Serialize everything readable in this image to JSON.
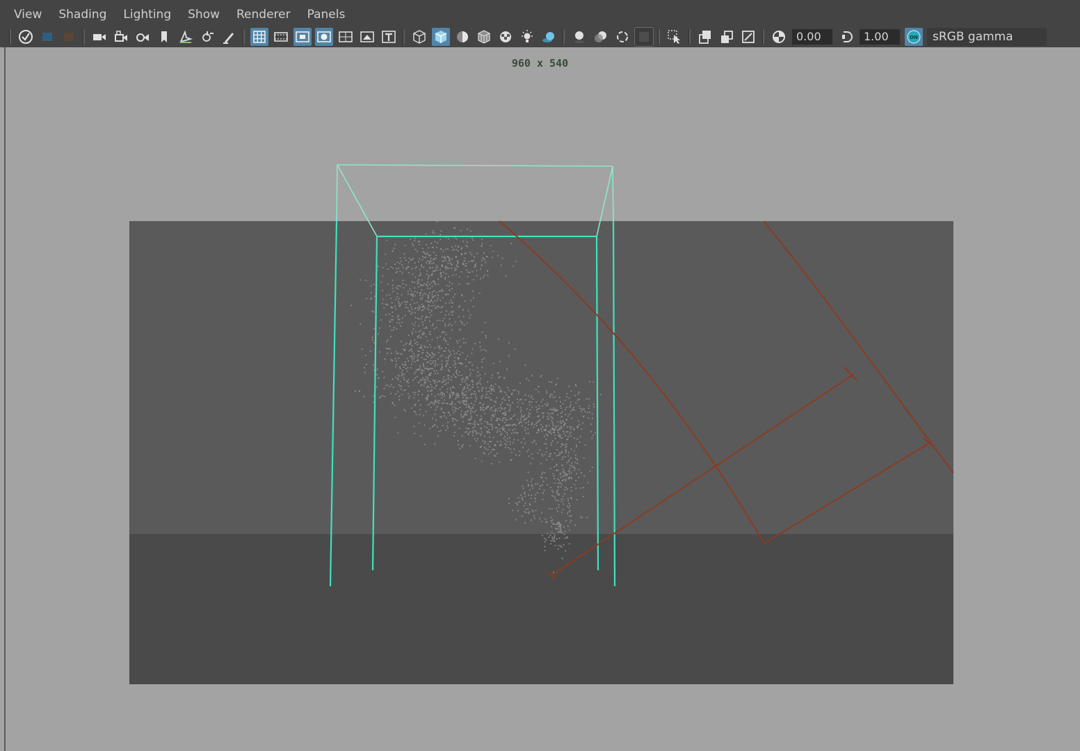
{
  "menu": [
    "View",
    "Shading",
    "Lighting",
    "Show",
    "Renderer",
    "Panels"
  ],
  "toolbar": {
    "exposure_value": "0.00",
    "gamma_value": "1.00",
    "color_space": "sRGB gamma",
    "color_management_badge": "ON"
  },
  "viewport": {
    "resolution_label": "960 x 540",
    "colors": {
      "background": "#a3a3a3",
      "resolution_gate": "#5a5a5a",
      "ground_plane": "#4a4a4a",
      "fluid_container": "#3fe3bd",
      "light_manip": "#8a3a22",
      "particles": "#8e8e8e"
    }
  }
}
